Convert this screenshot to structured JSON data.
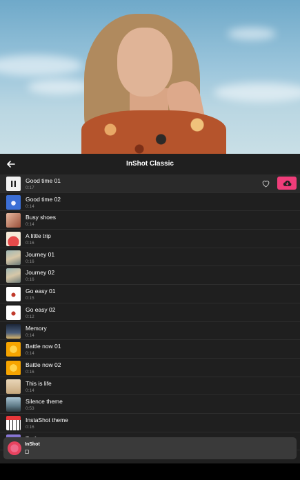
{
  "header": {
    "title": "InShot Classic"
  },
  "tracks": [
    {
      "name": "Good time 01",
      "duration": "0:17",
      "thumb": "pause-icon"
    },
    {
      "name": "Good time 02",
      "duration": "0:14",
      "thumb": "flower-thumb"
    },
    {
      "name": "Busy shoes",
      "duration": "0:14",
      "thumb": "portrait-thumb"
    },
    {
      "name": "A little trip",
      "duration": "0:16",
      "thumb": "watermelon-thumb"
    },
    {
      "name": "Journey 01",
      "duration": "0:16",
      "thumb": "street-thumb"
    },
    {
      "name": "Journey 02",
      "duration": "0:16",
      "thumb": "street-thumb"
    },
    {
      "name": "Go easy 01",
      "duration": "0:15",
      "thumb": "eye-thumb"
    },
    {
      "name": "Go easy 02",
      "duration": "0:12",
      "thumb": "eye-thumb"
    },
    {
      "name": "Memory",
      "duration": "0:14",
      "thumb": "night-thumb"
    },
    {
      "name": "Battle now 01",
      "duration": "0:14",
      "thumb": "orange-thumb"
    },
    {
      "name": "Battle now 02",
      "duration": "0:16",
      "thumb": "orange-thumb"
    },
    {
      "name": "This is life",
      "duration": "0:14",
      "thumb": "road-thumb"
    },
    {
      "name": "Silence theme",
      "duration": "0:53",
      "thumb": "landscape-thumb"
    },
    {
      "name": "InstaShot theme",
      "duration": "0:16",
      "thumb": "piano-thumb"
    },
    {
      "name": "To the ocean",
      "duration": "",
      "thumb": "ocean-thumb"
    }
  ],
  "player": {
    "title": "InShot"
  },
  "colors": {
    "accent": "#f03d7a",
    "background": "#1f1f1f"
  }
}
